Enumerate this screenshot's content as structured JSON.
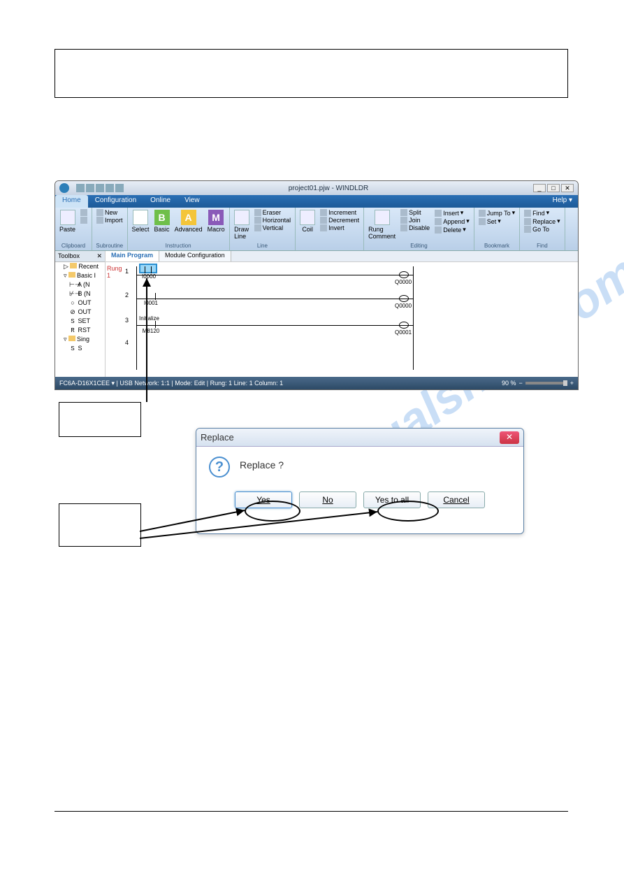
{
  "app": {
    "title_center": "project01.pjw - WINDLDR",
    "help": "Help"
  },
  "window_controls": {
    "min": "_",
    "max": "□",
    "close": "✕"
  },
  "ribbon_tabs": [
    "Home",
    "Configuration",
    "Online",
    "View"
  ],
  "ribbon": {
    "clipboard": {
      "paste": "Paste",
      "name": "Clipboard"
    },
    "subroutine": {
      "new": "New",
      "import": "Import",
      "name": "Subroutine"
    },
    "instruction": {
      "select": "Select",
      "basic": "Basic",
      "advanced": "Advanced",
      "macro": "Macro",
      "name": "Instruction"
    },
    "line": {
      "draw": "Draw\nLine",
      "eraser": "Eraser",
      "horizontal": "Horizontal",
      "vertical": "Vertical",
      "name": "Line"
    },
    "coil": {
      "coil": "Coil",
      "increment": "Increment",
      "decrement": "Decrement",
      "invert": "Invert",
      "name": ""
    },
    "editing": {
      "rung": "Rung\nComment",
      "split": "Split",
      "join": "Join",
      "disable": "Disable",
      "insert": "Insert",
      "append": "Append",
      "delete": "Delete",
      "name": "Editing"
    },
    "bookmark": {
      "jumpto": "Jump To",
      "set": "Set",
      "name": "Bookmark"
    },
    "find": {
      "find": "Find",
      "replace": "Replace",
      "goto": "Go To",
      "name": "Find"
    }
  },
  "toolbox": {
    "title": "Toolbox",
    "pin": "✕",
    "items": [
      {
        "icon": "folder",
        "label": "Recent"
      },
      {
        "icon": "folder",
        "label": "Basic I"
      },
      {
        "icon": "sym",
        "sym": "⊢⊣",
        "label": "A (N"
      },
      {
        "icon": "sym",
        "sym": "⊬⊣",
        "label": "B (N"
      },
      {
        "icon": "sym",
        "sym": "○",
        "label": "OUT"
      },
      {
        "icon": "sym",
        "sym": "⊘",
        "label": "OUT"
      },
      {
        "icon": "sym",
        "sym": "S",
        "label": "SET"
      },
      {
        "icon": "sym",
        "sym": "R",
        "label": "RST"
      },
      {
        "icon": "folder",
        "label": "Sing"
      },
      {
        "icon": "sym",
        "sym": "S",
        "label": "S"
      }
    ]
  },
  "doctabs": {
    "main": "Main Program",
    "module": "Module Configuration"
  },
  "ladder": {
    "rung_label": "Rung",
    "rung_no": "1",
    "lines": [
      "1",
      "2",
      "3",
      "4"
    ],
    "contacts": {
      "c1": "I0000",
      "c2": "I0001",
      "c3a": "Initialize",
      "c3b": "M8120"
    },
    "coils": {
      "q0": "Q0000",
      "q1": "Q0000",
      "q2": "Q0001"
    }
  },
  "statusbar": {
    "left": "FC6A-D16X1CEE ▾   | USB    Network: 1:1  |  Mode: Edit  |  Rung: 1    Line: 1    Column: 1",
    "zoom": "90 %"
  },
  "dialog": {
    "title": "Replace",
    "message": "Replace ?",
    "yes": "Yes",
    "no": "No",
    "yestoall": "Yes to all",
    "cancel": "Cancel"
  }
}
